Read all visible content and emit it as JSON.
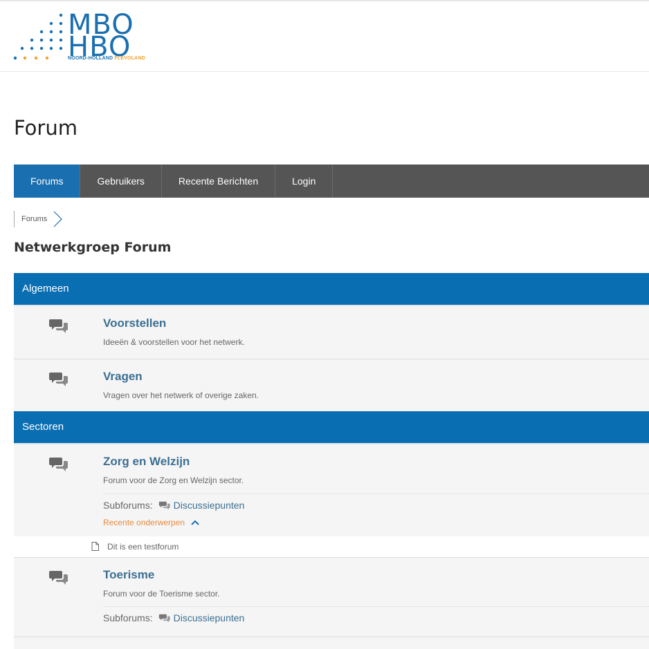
{
  "logo": {
    "line1": "MBO",
    "line2": "HBO",
    "region_part1": "NOORD-HOLLAND",
    "region_part2": "FLEVOLAND",
    "colors": {
      "blue": "#1a6fb0",
      "orange": "#f0a030"
    }
  },
  "page_title": "Forum",
  "nav": {
    "items": [
      {
        "label": "Forums",
        "active": true
      },
      {
        "label": "Gebruikers",
        "active": false
      },
      {
        "label": "Recente Berichten",
        "active": false
      },
      {
        "label": "Login",
        "active": false
      }
    ]
  },
  "breadcrumb": {
    "items": [
      "Forums"
    ]
  },
  "subtitle": "Netwerkgroep Forum",
  "sections": [
    {
      "title": "Algemeen",
      "forums": [
        {
          "title": "Voorstellen",
          "description": "Ideeën & voorstellen voor het netwerk.",
          "icon": "comments-icon"
        },
        {
          "title": "Vragen",
          "description": "Vragen over het netwerk of overige zaken.",
          "icon": "comments-icon"
        }
      ]
    },
    {
      "title": "Sectoren",
      "forums": [
        {
          "title": "Zorg en Welzijn",
          "description": "Forum voor de Zorg en Welzijn sector.",
          "icon": "comments-icon",
          "subforums_label": "Subforums:",
          "subforums": [
            "Discussiepunten"
          ],
          "recent_toggle": "Recente onderwerpen",
          "recent_topics": [
            "Dit is een testforum"
          ]
        },
        {
          "title": "Toerisme",
          "description": "Forum voor de Toerisme sector.",
          "icon": "comments-icon",
          "subforums_label": "Subforums:",
          "subforums": [
            "Discussiepunten"
          ]
        }
      ]
    }
  ],
  "colors": {
    "accent": "#0a6eb2",
    "nav_bg": "#555555",
    "link": "#3c6f93",
    "toggle": "#e98a3c",
    "row_bg": "#f5f5f5"
  }
}
